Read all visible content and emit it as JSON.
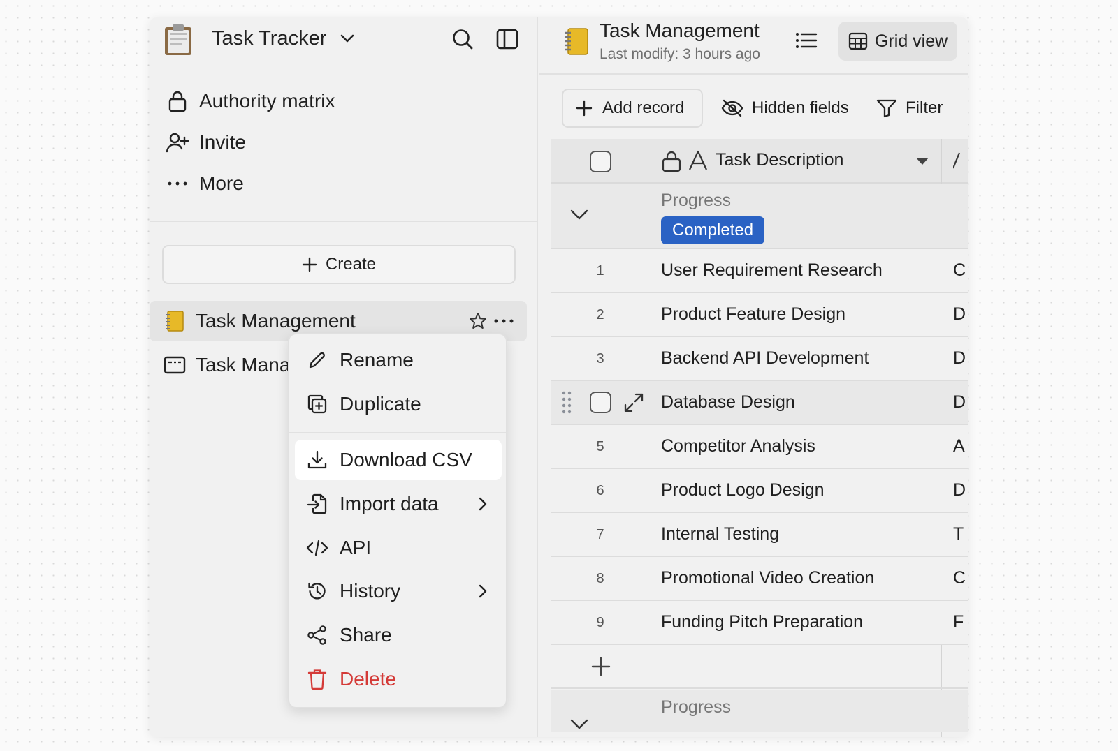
{
  "app": {
    "title": "Task Tracker"
  },
  "sidebar": {
    "items": [
      {
        "label": "Authority matrix",
        "icon": "lock-icon"
      },
      {
        "label": "Invite",
        "icon": "user-plus-icon"
      },
      {
        "label": "More",
        "icon": "more-horizontal-icon"
      }
    ],
    "create_label": "Create",
    "nodes": [
      {
        "label": "Task Management",
        "icon": "notebook-icon"
      },
      {
        "label": "Task Mana",
        "icon": "form-icon"
      }
    ]
  },
  "context_menu": {
    "items": [
      {
        "label": "Rename",
        "icon": "pencil-icon"
      },
      {
        "label": "Duplicate",
        "icon": "duplicate-icon"
      },
      {
        "label": "Download CSV",
        "icon": "download-icon"
      },
      {
        "label": "Import data",
        "icon": "import-icon"
      },
      {
        "label": "API",
        "icon": "code-icon"
      },
      {
        "label": "History",
        "icon": "history-icon"
      },
      {
        "label": "Share",
        "icon": "share-icon"
      },
      {
        "label": "Delete",
        "icon": "trash-icon"
      }
    ]
  },
  "main": {
    "title": "Task Management",
    "subtitle": "Last modify: 3 hours ago",
    "view_label": "Grid view",
    "toolbar": {
      "add_record": "Add record",
      "hidden_fields": "Hidden fields",
      "filter": "Filter"
    },
    "table": {
      "column_header": "Task Description",
      "group_label": "Progress",
      "group_value": "Completed",
      "rows": [
        {
          "num": "1",
          "desc": "User Requirement Research",
          "next": "C"
        },
        {
          "num": "2",
          "desc": "Product Feature Design",
          "next": "D"
        },
        {
          "num": "3",
          "desc": "Backend API Development",
          "next": "D"
        },
        {
          "num": "",
          "desc": "Database Design",
          "next": "D"
        },
        {
          "num": "5",
          "desc": "Competitor Analysis",
          "next": "A"
        },
        {
          "num": "6",
          "desc": "Product Logo Design",
          "next": "D"
        },
        {
          "num": "7",
          "desc": "Internal Testing",
          "next": "T"
        },
        {
          "num": "8",
          "desc": "Promotional Video Creation",
          "next": "C"
        },
        {
          "num": "9",
          "desc": "Funding Pitch Preparation",
          "next": "F"
        }
      ],
      "group2_label": "Progress"
    }
  },
  "colors": {
    "badge": "#2a62c4",
    "danger": "#d43a37",
    "panel": "#f1f1f1"
  }
}
